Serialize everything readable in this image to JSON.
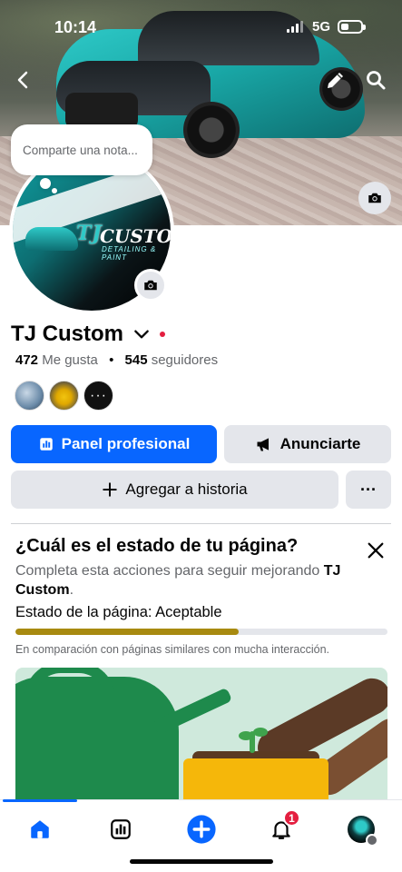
{
  "status_bar": {
    "time": "10:14",
    "network": "5G"
  },
  "note": {
    "placeholder": "Comparte una nota..."
  },
  "profile": {
    "name": "TJ Custom",
    "likes_count": "472",
    "likes_label": "Me gusta",
    "followers_count": "545",
    "followers_label": "seguidores",
    "logo": {
      "main": "CUSTOM",
      "tj": "TJ",
      "sub": "DETAILING & PAINT"
    }
  },
  "friends": {
    "more_glyph": "···"
  },
  "actions": {
    "dashboard_label": "Panel profesional",
    "advertise_label": "Anunciarte",
    "add_story_label": "Agregar a historia",
    "more_glyph": "···"
  },
  "status_card": {
    "title": "¿Cuál es el estado de tu página?",
    "desc_prefix": "Completa esta acciones para seguir mejorando",
    "desc_page": "TJ Custom",
    "desc_suffix": ".",
    "state_label": "Estado de la página:",
    "state_value": "Aceptable",
    "progress_fraction": 0.6,
    "compare_text": "En comparación con páginas similares con mucha interacción."
  },
  "tabbar": {
    "notifications_badge": "1"
  },
  "colors": {
    "primary": "#0866ff",
    "button_gray": "#e4e6eb",
    "progress": "#a88a10",
    "badge": "#e41e3f",
    "secondary_text": "#65676b"
  },
  "icons": [
    "back-arrow-icon",
    "pencil-icon",
    "search-icon",
    "camera-icon",
    "chevron-down-icon",
    "chart-bars-icon",
    "megaphone-icon",
    "plus-icon",
    "close-icon",
    "home-icon",
    "insights-icon",
    "create-plus-icon",
    "bell-icon"
  ]
}
